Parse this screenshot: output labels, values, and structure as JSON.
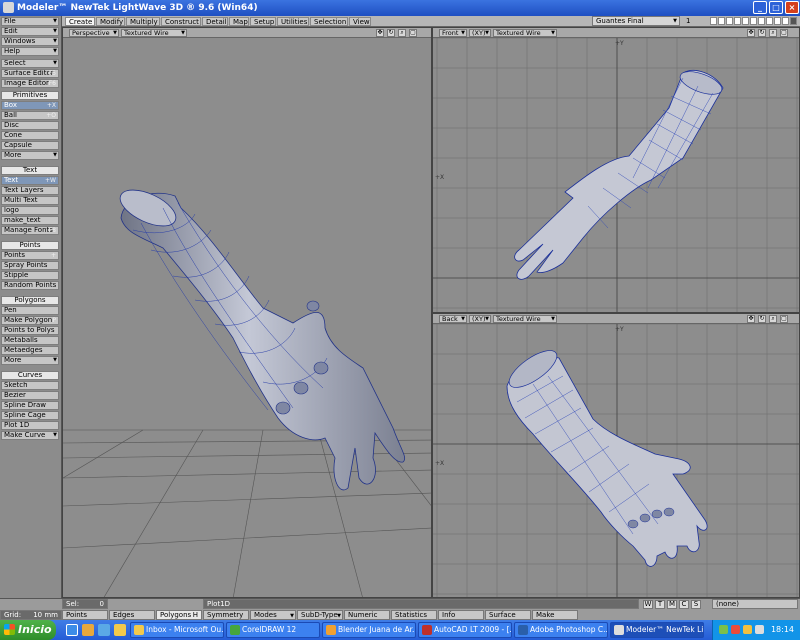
{
  "window": {
    "title": "Modeler™ NewTek LightWave 3D ® 9.6  (Win64)",
    "controls": [
      "_",
      "□",
      "×"
    ]
  },
  "tabs": [
    "Create",
    "Modify",
    "Multiply",
    "Construct",
    "Detail",
    "Map",
    "Setup",
    "Utilities",
    "Selection",
    "View"
  ],
  "active_tab": "Create",
  "layer": {
    "selected": "Guantes Final",
    "num": "1"
  },
  "sidebar": {
    "top_menus": [
      "File",
      "Edit",
      "Windows",
      "Help"
    ],
    "tools": [
      {
        "label": "Select",
        "dd": true
      },
      {
        "label": "Surface Editor",
        "sc": "F5"
      },
      {
        "label": "Image Editor",
        "sc": "F6"
      }
    ],
    "sections": [
      {
        "title": "Primitives",
        "items": [
          {
            "label": "Box",
            "sc": "+X",
            "hl": true
          },
          {
            "label": "Ball",
            "sc": "+O"
          },
          {
            "label": "Disc"
          },
          {
            "label": "Cone"
          },
          {
            "label": "Capsule"
          },
          {
            "label": "More",
            "dd": true
          }
        ]
      },
      {
        "title": "Text",
        "items": [
          {
            "label": "Text",
            "sc": "+W",
            "hl": true
          },
          {
            "label": "Text Layers"
          },
          {
            "label": "Multi Text"
          },
          {
            "label": "logo"
          },
          {
            "label": "make_text"
          },
          {
            "label": "Manage Fonts",
            "sc": "F8"
          }
        ]
      },
      {
        "title": "Points",
        "items": [
          {
            "label": "Points",
            "sc": "+"
          },
          {
            "label": "Spray Points"
          },
          {
            "label": "Stipple"
          },
          {
            "label": "Random Points"
          }
        ]
      },
      {
        "title": "Polygons",
        "items": [
          {
            "label": "Pen"
          },
          {
            "label": "Make Polygon",
            "sc": "P"
          },
          {
            "label": "Points to Polys"
          },
          {
            "label": "Metaballs"
          },
          {
            "label": "Metaedges"
          },
          {
            "label": "More",
            "dd": true
          }
        ]
      },
      {
        "title": "Curves",
        "items": [
          {
            "label": "Sketch"
          },
          {
            "label": "Bezier"
          },
          {
            "label": "Spline Draw"
          },
          {
            "label": "Spline Cage"
          },
          {
            "label": "Plot 1D"
          },
          {
            "label": "Make Curve",
            "dd": true
          }
        ]
      }
    ]
  },
  "viewports": {
    "perspective": {
      "view": "Perspective",
      "shading": "Textured Wire"
    },
    "front": {
      "view": "Front",
      "axes": "(XY)",
      "shading": "Textured Wire",
      "axis_top": "+Y",
      "axis_left": "+X"
    },
    "back": {
      "view": "Back",
      "axes": "(XY)",
      "shading": "Textured Wire",
      "axis_top": "+Y",
      "axis_left": "+X"
    }
  },
  "status": {
    "sel_label": "Sel:",
    "sel_value": "0",
    "message": "Plot1D",
    "grid_label": "Grid:",
    "grid_value": "10 mm",
    "modes": [
      {
        "label": "Points"
      },
      {
        "label": "Edges"
      },
      {
        "label": "Polygons",
        "sc": "H",
        "active": true
      },
      {
        "label": "Symmetry"
      },
      {
        "label": "Modes",
        "dd": true
      },
      {
        "label": "SubD-Type",
        "dd": true
      },
      {
        "label": "Numeric"
      },
      {
        "label": "Statistics"
      },
      {
        "label": "Info"
      },
      {
        "label": "Surface"
      },
      {
        "label": "Make"
      }
    ],
    "twmc": [
      "W",
      "T",
      "M",
      "C",
      "S"
    ],
    "vmap": "(none)"
  },
  "taskbar": {
    "start": "Inicio",
    "tasks": [
      {
        "label": "Inbox - Microsoft Ou...",
        "color": "#f2c94c"
      },
      {
        "label": "CorelDRAW 12",
        "color": "#46a63d"
      },
      {
        "label": "Blender Juana de Ar...",
        "color": "#f0a030"
      },
      {
        "label": "AutoCAD LT 2009 - [...",
        "color": "#c0302a"
      },
      {
        "label": "Adobe Photoshop C...",
        "color": "#2a5faa"
      },
      {
        "label": "Modeler™ NewTek Li...",
        "color": "#ddd",
        "active": true
      }
    ],
    "clock": "18:14"
  }
}
